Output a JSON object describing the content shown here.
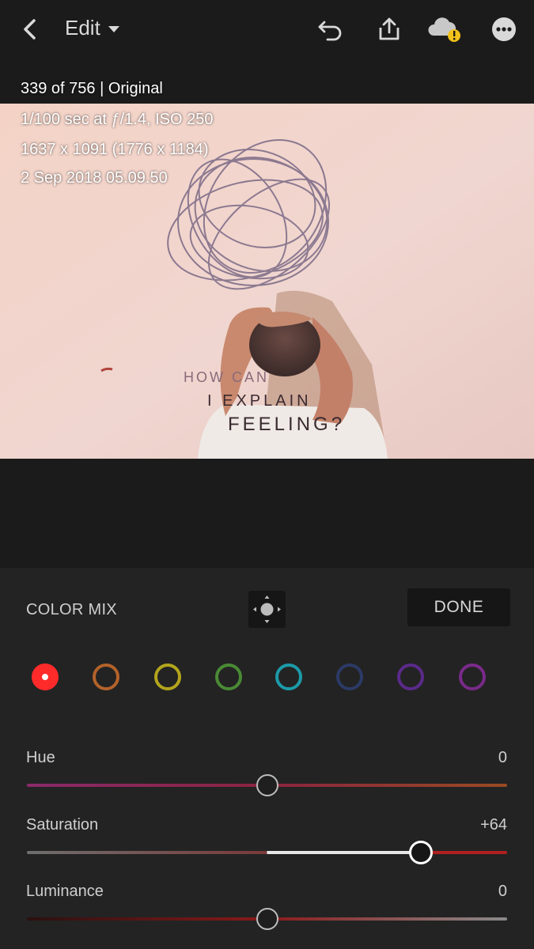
{
  "topbar": {
    "title": "Edit",
    "icons": [
      "back-icon",
      "undo-icon",
      "share-icon",
      "cloud-warning-icon",
      "more-icon"
    ]
  },
  "photo": {
    "info_lines": [
      "339 of 756 | Original",
      "1/100 sec at ƒ/1.4, ISO 250",
      "1637 x 1091 (1776 x 1184)",
      "2 Sep 2018 05.09.50"
    ],
    "wall_text_1": "HOW CAN",
    "wall_text_2": "I EXPLAIN",
    "wall_text_3": "FEELING?"
  },
  "panel": {
    "title": "COLOR MIX",
    "done_label": "DONE",
    "swatches": [
      {
        "name": "red",
        "color": "#ff2a2a",
        "selected": true
      },
      {
        "name": "orange",
        "color": "#b3622a"
      },
      {
        "name": "yellow",
        "color": "#b3a51c"
      },
      {
        "name": "green",
        "color": "#4a8a35"
      },
      {
        "name": "aqua",
        "color": "#1c9aa8"
      },
      {
        "name": "blue",
        "color": "#2c3a66"
      },
      {
        "name": "purple",
        "color": "#5b2a8a"
      },
      {
        "name": "magenta",
        "color": "#7a2a8a"
      }
    ],
    "sliders": [
      {
        "label": "Hue",
        "value": "0",
        "position": 0.5
      },
      {
        "label": "Saturation",
        "value": "+64",
        "position": 0.82
      },
      {
        "label": "Luminance",
        "value": "0",
        "position": 0.5
      }
    ]
  }
}
